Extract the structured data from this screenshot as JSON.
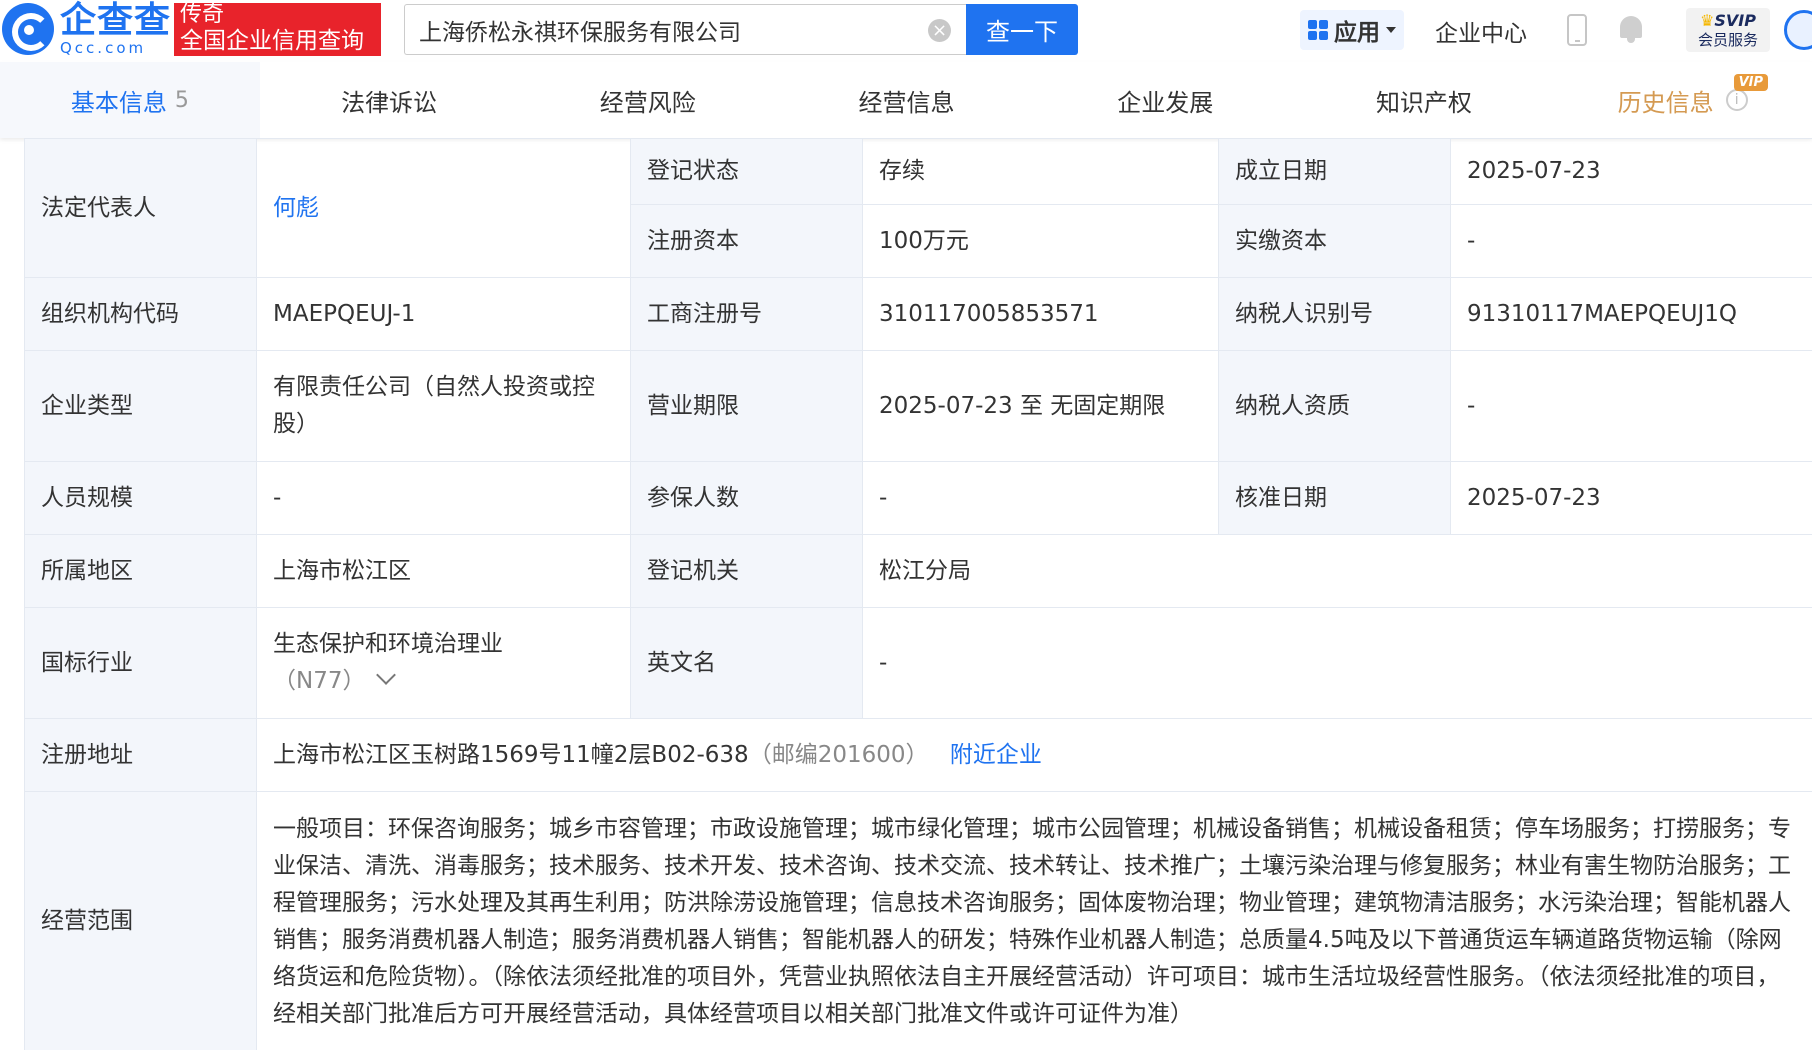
{
  "header": {
    "logo_cn": "企查查",
    "logo_en": "Qcc.com",
    "promo_top": "传奇",
    "promo_bottom": "全国企业信用查询",
    "search_value": "上海侨松永祺环保服务有限公司",
    "clear_symbol": "×",
    "search_button": "查一下",
    "app_label": "应用",
    "enterprise_center": "企业中心",
    "svip_top": "SVIP",
    "svip_bottom": "会员服务"
  },
  "tabs": [
    {
      "label": "基本信息",
      "count": "5"
    },
    {
      "label": "法律诉讼"
    },
    {
      "label": "经营风险"
    },
    {
      "label": "经营信息"
    },
    {
      "label": "企业发展"
    },
    {
      "label": "知识产权"
    },
    {
      "label": "历史信息",
      "badge": "VIP",
      "info": "i"
    }
  ],
  "info": {
    "legal_rep_label": "法定代表人",
    "legal_rep_value": "何彪",
    "reg_status_label": "登记状态",
    "reg_status_value": "存续",
    "found_date_label": "成立日期",
    "found_date_value": "2025-07-23",
    "reg_capital_label": "注册资本",
    "reg_capital_value": "100万元",
    "paid_capital_label": "实缴资本",
    "paid_capital_value": "-",
    "org_code_label": "组织机构代码",
    "org_code_value": "MAEPQEUJ-1",
    "biz_reg_no_label": "工商注册号",
    "biz_reg_no_value": "310117005853571",
    "taxpayer_id_label": "纳税人识别号",
    "taxpayer_id_value": "91310117MAEPQEUJ1Q",
    "company_type_label": "企业类型",
    "company_type_value": "有限责任公司（自然人投资或控股）",
    "biz_term_label": "营业期限",
    "biz_term_value": "2025-07-23 至 无固定期限",
    "taxpayer_qual_label": "纳税人资质",
    "taxpayer_qual_value": "-",
    "staff_size_label": "人员规模",
    "staff_size_value": "-",
    "insured_label": "参保人数",
    "insured_value": "-",
    "approval_date_label": "核准日期",
    "approval_date_value": "2025-07-23",
    "region_label": "所属地区",
    "region_value": "上海市松江区",
    "reg_authority_label": "登记机关",
    "reg_authority_value": "松江分局",
    "industry_label": "国标行业",
    "industry_value": "生态保护和环境治理业",
    "industry_code": "（N77）",
    "english_name_label": "英文名",
    "english_name_value": "-",
    "address_label": "注册地址",
    "address_value": "上海市松江区玉树路1569号11幢2层B02-638",
    "postcode": "（邮编201600）",
    "nearby_link": "附近企业",
    "scope_label": "经营范围",
    "scope_value": "一般项目：环保咨询服务；城乡市容管理；市政设施管理；城市绿化管理；城市公园管理；机械设备销售；机械设备租赁；停车场服务；打捞服务；专业保洁、清洗、消毒服务；技术服务、技术开发、技术咨询、技术交流、技术转让、技术推广；土壤污染治理与修复服务；林业有害生物防治服务；工程管理服务；污水处理及其再生利用；防洪除涝设施管理；信息技术咨询服务；固体废物治理；物业管理；建筑物清洁服务；水污染治理；智能机器人销售；服务消费机器人制造；服务消费机器人销售；智能机器人的研发；特殊作业机器人制造；总质量4.5吨及以下普通货运车辆道路货物运输（除网络货运和危险货物）。（除依法须经批准的项目外，凭营业执照依法自主开展经营活动）许可项目：城市生活垃圾经营性服务。（依法须经批准的项目，经相关部门批准后方可开展经营活动，具体经营项目以相关部门批准文件或许可证件为准）"
  }
}
